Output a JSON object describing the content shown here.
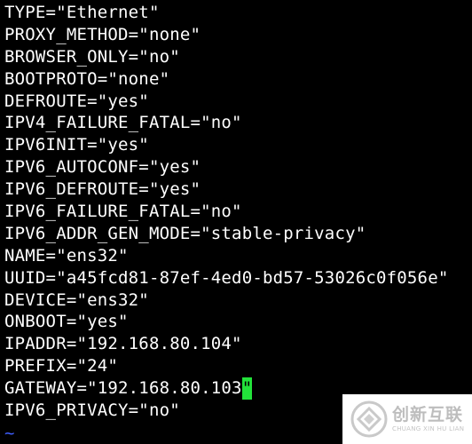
{
  "colors": {
    "background": "#000000",
    "text": "#ffffff",
    "cursor": "#22e23a",
    "tilde": "#3f5fff",
    "watermark_bg": "#ffffff",
    "watermark_text": "#bdbdbd"
  },
  "editor": {
    "lines": [
      "TYPE=\"Ethernet\"",
      "PROXY_METHOD=\"none\"",
      "BROWSER_ONLY=\"no\"",
      "BOOTPROTO=\"none\"",
      "DEFROUTE=\"yes\"",
      "IPV4_FAILURE_FATAL=\"no\"",
      "IPV6INIT=\"yes\"",
      "IPV6_AUTOCONF=\"yes\"",
      "IPV6_DEFROUTE=\"yes\"",
      "IPV6_FAILURE_FATAL=\"no\"",
      "IPV6_ADDR_GEN_MODE=\"stable-privacy\"",
      "NAME=\"ens32\"",
      "UUID=\"a45fcd81-87ef-4ed0-bd57-53026c0f056e\"",
      "DEVICE=\"ens32\"",
      "ONBOOT=\"yes\"",
      "IPADDR=\"192.168.80.104\"",
      "PREFIX=\"24\""
    ],
    "cursor_line": {
      "before_cursor": "GATEWAY=\"192.168.80.103",
      "cursor_char": "\""
    },
    "after_cursor_lines": [
      "IPV6_PRIVACY=\"no\""
    ],
    "empty_line_marker": "~"
  },
  "watermark": {
    "logo_icon": "cdcxhl-logo-icon",
    "text_cn": "创新互联",
    "text_en": "CHUANG XIN HU LIAN"
  }
}
